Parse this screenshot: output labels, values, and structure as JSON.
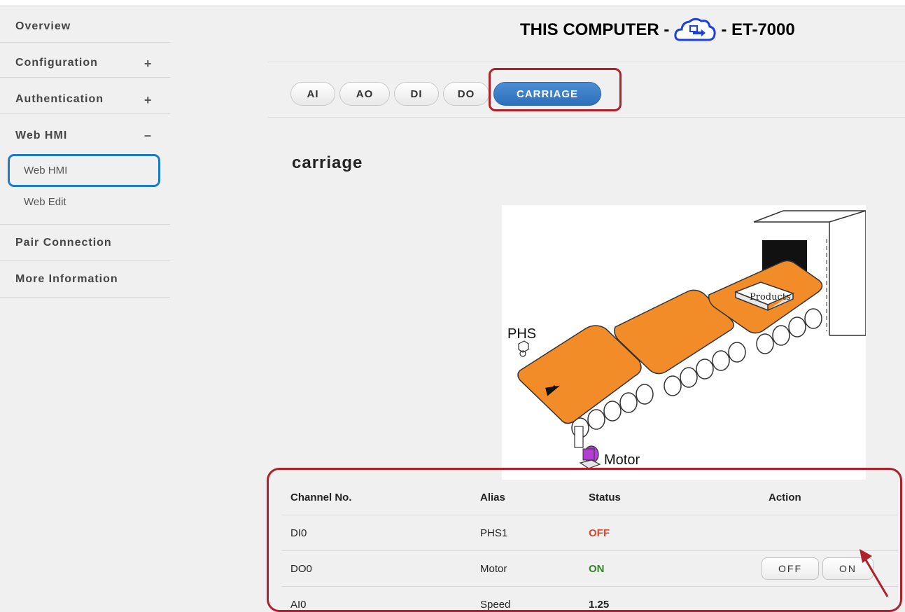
{
  "sidebar": {
    "items": [
      {
        "label": "Overview",
        "toggle": ""
      },
      {
        "label": "Configuration",
        "toggle": "+"
      },
      {
        "label": "Authentication",
        "toggle": "+"
      },
      {
        "label": "Web HMI",
        "toggle": "–"
      },
      {
        "label": "Pair Connection",
        "toggle": ""
      },
      {
        "label": "More Information",
        "toggle": ""
      }
    ],
    "subitems": [
      {
        "label": "Web HMI",
        "selected": true
      },
      {
        "label": "Web Edit",
        "selected": false
      }
    ]
  },
  "header": {
    "left": "THIS COMPUTER -",
    "right": "- ET-7000",
    "icon": "cloud-icon"
  },
  "tabs": [
    {
      "label": "AI"
    },
    {
      "label": "AO"
    },
    {
      "label": "DI"
    },
    {
      "label": "DO"
    },
    {
      "label": "CARRIAGE",
      "active": true
    }
  ],
  "page_title": "carriage",
  "diagram": {
    "labels": {
      "phs": "PHS",
      "products": "Products",
      "motor": "Motor"
    },
    "belt_color": "#f28c28",
    "motor_color": "#b23fd1"
  },
  "table": {
    "headers": {
      "channel": "Channel No.",
      "alias": "Alias",
      "status": "Status",
      "action": "Action"
    },
    "rows": [
      {
        "channel": "DI0",
        "alias": "PHS1",
        "status": "OFF"
      },
      {
        "channel": "DO0",
        "alias": "Motor",
        "status": "ON",
        "off_label": "OFF",
        "on_label": "ON"
      },
      {
        "channel": "AI0",
        "alias": "Speed",
        "status": "1.25"
      }
    ]
  },
  "colors": {
    "highlight_red": "#b0202a",
    "highlight_blue": "#1e7cc5",
    "status_off": "#e0452a",
    "status_on": "#2d8a1f"
  }
}
